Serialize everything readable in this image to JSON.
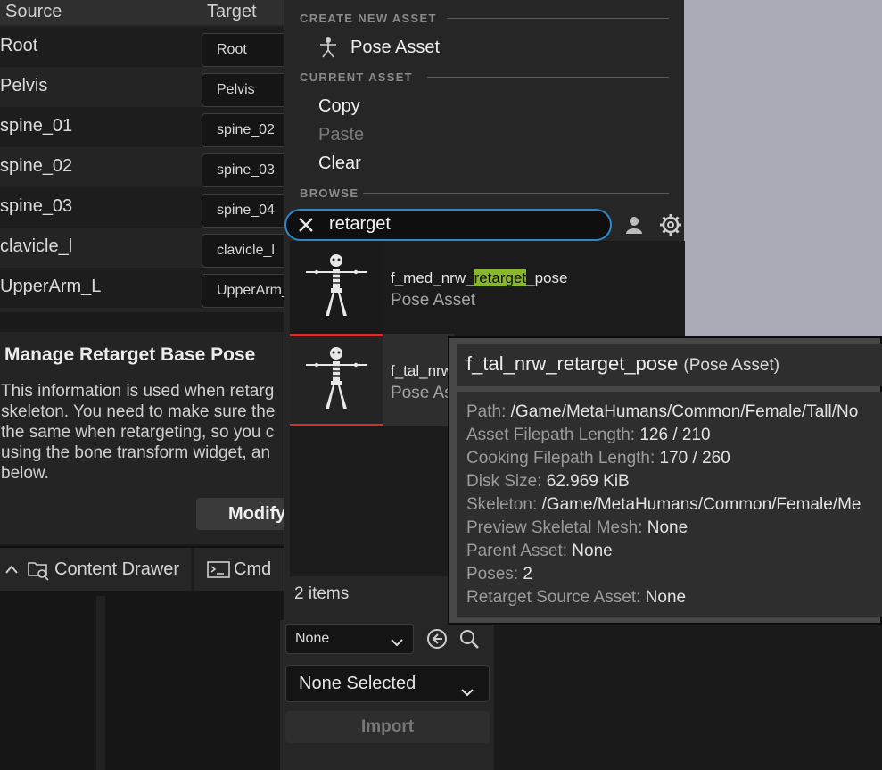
{
  "bone_table": {
    "headers": {
      "source": "Source",
      "target": "Target"
    },
    "rows": [
      {
        "source": "Root",
        "target": "Root"
      },
      {
        "source": "Pelvis",
        "target": "Pelvis"
      },
      {
        "source": "spine_01",
        "target": "spine_02"
      },
      {
        "source": "spine_02",
        "target": "spine_03"
      },
      {
        "source": "spine_03",
        "target": "spine_04"
      },
      {
        "source": "clavicle_l",
        "target": "clavicle_l"
      },
      {
        "source": "UpperArm_L",
        "target": "UpperArm_"
      }
    ]
  },
  "manage": {
    "title": "Manage Retarget Base Pose",
    "description": "This information is used when retarg\nskeleton. You need to make sure the\nthe same when retargeting, so you c\nusing the bone transform widget, an\nbelow.",
    "modify_label": "Modify"
  },
  "bottom_bar": {
    "content_drawer": "Content Drawer",
    "cmd": "Cmd"
  },
  "menu": {
    "create_header": "CREATE NEW ASSET",
    "create_item": "Pose Asset",
    "current_header": "CURRENT ASSET",
    "copy": "Copy",
    "paste": "Paste",
    "clear": "Clear",
    "browse_header": "BROWSE",
    "search_value": "retarget"
  },
  "assets": [
    {
      "name_pre": "f_med_nrw_",
      "name_hl": "retarget",
      "name_post": "_pose",
      "type": "Pose Asset"
    },
    {
      "name_pre": "f_tal_nrw",
      "name_hl": "",
      "name_post": "",
      "type": "Pose As"
    }
  ],
  "items_count": "2 items",
  "picker": {
    "filter_value": "None",
    "selected_value": "None Selected",
    "import_label": "Import"
  },
  "tooltip": {
    "title": "f_tal_nrw_retarget_pose",
    "subtitle": "(Pose Asset)",
    "rows": [
      {
        "key": "Path:",
        "value": "/Game/MetaHumans/Common/Female/Tall/No"
      },
      {
        "key": "Asset Filepath Length:",
        "value": "126 / 210"
      },
      {
        "key": "Cooking Filepath Length:",
        "value": "170 / 260"
      },
      {
        "key": "Disk Size:",
        "value": "62.969 KiB"
      },
      {
        "key": "Skeleton:",
        "value": "/Game/MetaHumans/Common/Female/Me"
      },
      {
        "key": "Preview Skeletal Mesh:",
        "value": "None"
      },
      {
        "key": "Parent Asset:",
        "value": "None"
      },
      {
        "key": "Poses:",
        "value": "2"
      },
      {
        "key": "Retarget Source Asset:",
        "value": "None"
      }
    ]
  },
  "colors": {
    "search_border": "#2f87c8",
    "highlight": "#89b72a",
    "selection_bar": "#d62d2d",
    "viewport": "#a9acb7"
  }
}
